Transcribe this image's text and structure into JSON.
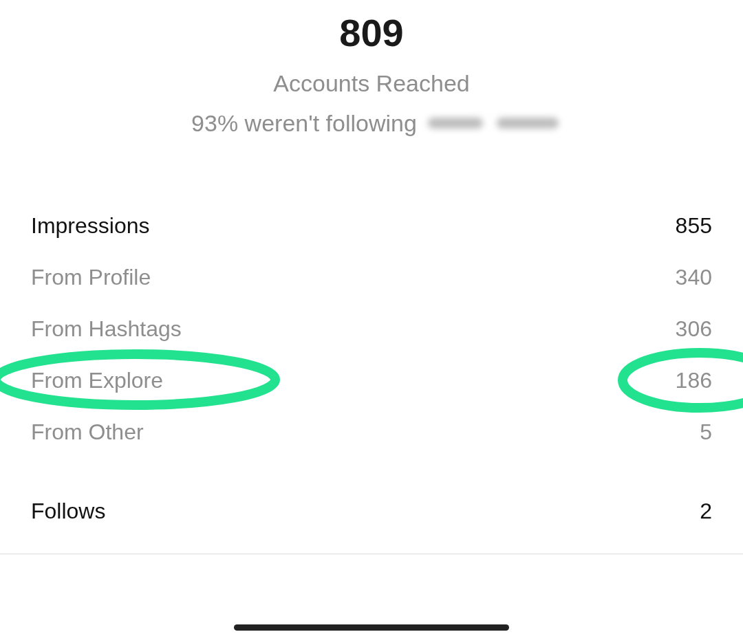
{
  "summary": {
    "value": "809",
    "label": "Accounts Reached",
    "note": "93% weren't following"
  },
  "rows": [
    {
      "kind": "main",
      "label": "Impressions",
      "value": "855",
      "highlighted": false
    },
    {
      "kind": "sub",
      "label": "From Profile",
      "value": "340",
      "highlighted": false
    },
    {
      "kind": "sub",
      "label": "From Hashtags",
      "value": "306",
      "highlighted": false
    },
    {
      "kind": "sub",
      "label": "From Explore",
      "value": "186",
      "highlighted": true
    },
    {
      "kind": "sub",
      "label": "From Other",
      "value": "5",
      "highlighted": false
    },
    {
      "kind": "gap"
    },
    {
      "kind": "main",
      "label": "Follows",
      "value": "2",
      "highlighted": false
    }
  ]
}
